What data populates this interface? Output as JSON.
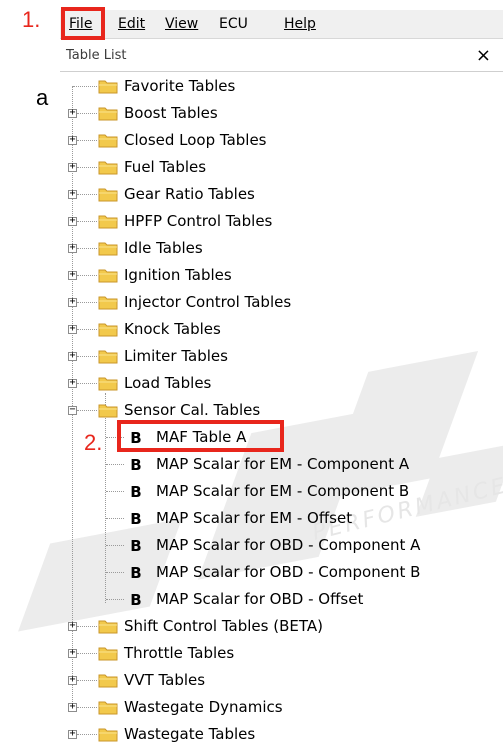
{
  "annotations": {
    "step1": "1.",
    "step2": "2.",
    "cut_text": "a"
  },
  "menu": {
    "file": "File",
    "edit": "Edit",
    "view": "View",
    "ecu": "ECU",
    "help": "Help"
  },
  "panel": {
    "title": "Table List",
    "close": "×"
  },
  "tree": {
    "top_folders": [
      "Favorite Tables",
      "Boost Tables",
      "Closed Loop Tables",
      "Fuel Tables",
      "Gear Ratio Tables",
      "HPFP Control Tables",
      "Idle Tables",
      "Ignition Tables",
      "Injector Control Tables",
      "Knock Tables",
      "Limiter Tables",
      "Load Tables"
    ],
    "expanded_folder": "Sensor Cal. Tables",
    "sensor_tables": [
      "MAF Table A",
      "MAP Scalar for EM - Component A",
      "MAP Scalar for EM - Component B",
      "MAP Scalar for EM - Offset",
      "MAP Scalar for OBD - Component A",
      "MAP Scalar for OBD - Component B",
      "MAP Scalar for OBD - Offset"
    ],
    "bottom_folders": [
      "Shift Control Tables (BETA)",
      "Throttle Tables",
      "VVT Tables",
      "Wastegate Dynamics",
      "Wastegate Tables"
    ],
    "table_icon": "B"
  },
  "colors": {
    "highlight": "#e8261c",
    "folder": "#f2c94c"
  }
}
